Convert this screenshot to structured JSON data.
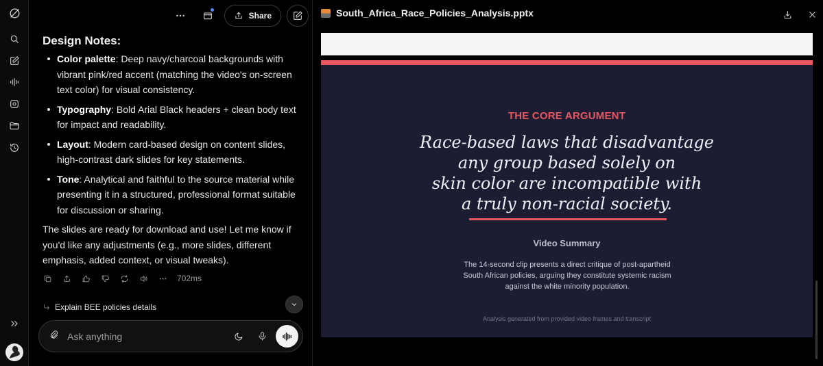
{
  "sidebar": {
    "icons": [
      "logo-icon",
      "search-icon",
      "edit-icon",
      "voice-icon",
      "discover-icon",
      "folder-icon",
      "history-icon",
      "expand-icon",
      "avatar"
    ]
  },
  "chat": {
    "toolbar": {
      "share_label": "Share"
    },
    "message": {
      "heading": "Design Notes:",
      "bullets": [
        {
          "term": "Color palette",
          "text": ": Deep navy/charcoal backgrounds with vibrant pink/red accent (matching the video's on-screen text color) for visual consistency."
        },
        {
          "term": "Typography",
          "text": ": Bold Arial Black headers + clean body text for impact and readability."
        },
        {
          "term": "Layout",
          "text": ": Modern card-based design on content slides, high-contrast dark slides for key statements."
        },
        {
          "term": "Tone",
          "text": ": Analytical and faithful to the source material while presenting it in a structured, professional format suitable for discussion or sharing."
        }
      ],
      "closing": "The slides are ready for download and use! Let me know if you'd like any adjustments (e.g., more slides, different emphasis, added context, or visual tweaks)."
    },
    "response_time": "702ms",
    "followup": "Explain BEE policies details",
    "composer": {
      "placeholder": "Ask anything"
    }
  },
  "preview": {
    "file_name": "South_Africa_Race_Policies_Analysis.pptx",
    "slide": {
      "kicker": "THE CORE ARGUMENT",
      "quote": "Race-based laws that disadvantage any group based solely on skin color are incompatible with a truly non-racial society.",
      "subheading": "Video Summary",
      "body": "The 14-second clip presents a direct critique of post-apartheid South African policies, arguing they constitute systemic racism against the white minority population.",
      "footer": "Analysis generated from provided video frames and transcript"
    },
    "colors": {
      "slide_bg": "#1c1d33",
      "accent": "#e8575f"
    }
  }
}
